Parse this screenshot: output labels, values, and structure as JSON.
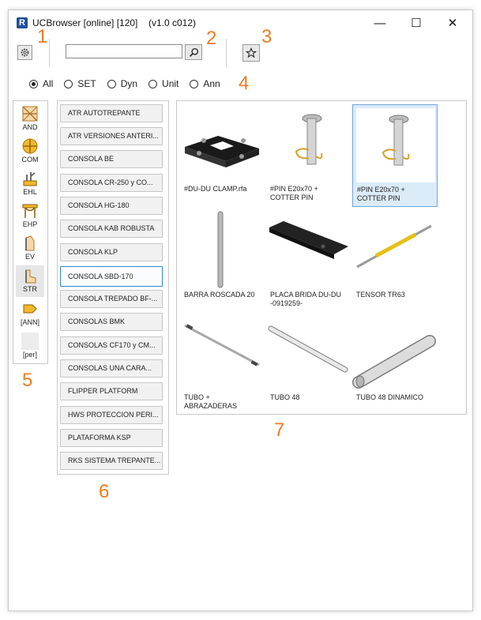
{
  "window": {
    "title": "UCBrowser [online] [120]",
    "version": "(v1.0 c012)",
    "logo_letter": "R",
    "minimize_glyph": "—",
    "maximize_glyph": "☐",
    "close_glyph": "✕"
  },
  "annotations": [
    "1",
    "2",
    "3",
    "4",
    "5",
    "6",
    "7"
  ],
  "toolbar": {
    "search_value": "",
    "settings_icon": "gear-icon",
    "search_icon": "magnifier-icon",
    "favorite_icon": "star-icon"
  },
  "filters": {
    "options": [
      "All",
      "SET",
      "Dyn",
      "Unit",
      "Ann"
    ],
    "selected": "All"
  },
  "categories": [
    {
      "label": "AND",
      "icon": "and-icon"
    },
    {
      "label": "COM",
      "icon": "com-icon"
    },
    {
      "label": "EHL",
      "icon": "ehl-icon"
    },
    {
      "label": "EHP",
      "icon": "ehp-icon"
    },
    {
      "label": "EV",
      "icon": "ev-icon"
    },
    {
      "label": "STR",
      "icon": "str-icon",
      "selected": true
    },
    {
      "label": "[ANN]",
      "icon": "ann-icon"
    },
    {
      "label": "[per]",
      "icon": "per-icon"
    }
  ],
  "families": [
    "ATR AUTOTREPANTE",
    "ATR VERSIONES ANTERI...",
    "CONSOLA BE",
    "CONSOLA CR-250 y CO...",
    "CONSOLA HG-180",
    "CONSOLA KAB ROBUSTA",
    "CONSOLA KLP",
    "CONSOLA SBD-170",
    "CONSOLA TREPADO BF-...",
    "CONSOLAS BMK",
    "CONSOLAS CF170 y CM...",
    "CONSOLAS UNA CARA...",
    "FLIPPER PLATFORM",
    "HWS PROTECCION PERI...",
    "PLATAFORMA KSP",
    "RKS SISTEMA TREPANTE..."
  ],
  "selected_family": "CONSOLA SBD-170",
  "items": [
    {
      "label": "#DU-DU CLAMP.rfa",
      "icon": "clamp-thumbnail"
    },
    {
      "label": "#PIN E20x70 + COTTER PIN",
      "icon": "pin-thumbnail"
    },
    {
      "label": "#PIN E20x70 + COTTER PIN",
      "icon": "pin-thumbnail",
      "selected": true
    },
    {
      "label": "BARRA ROSCADA 20",
      "icon": "threaded-bar-thumbnail"
    },
    {
      "label": "PLACA BRIDA DU-DU -0919259-",
      "icon": "plate-thumbnail"
    },
    {
      "label": "TENSOR TR63",
      "icon": "tensor-thumbnail"
    },
    {
      "label": "TUBO + ABRAZADERAS",
      "icon": "tube-clamps-thumbnail"
    },
    {
      "label": "TUBO 48",
      "icon": "tube-thumbnail"
    },
    {
      "label": "TUBO 48 DINAMICO",
      "icon": "tube-dynamic-thumbnail"
    }
  ],
  "colors": {
    "accent": "#f07a20",
    "selection": "#2b88d8",
    "tile_selection": "#dbebf8",
    "logo": "#1f4f99"
  }
}
